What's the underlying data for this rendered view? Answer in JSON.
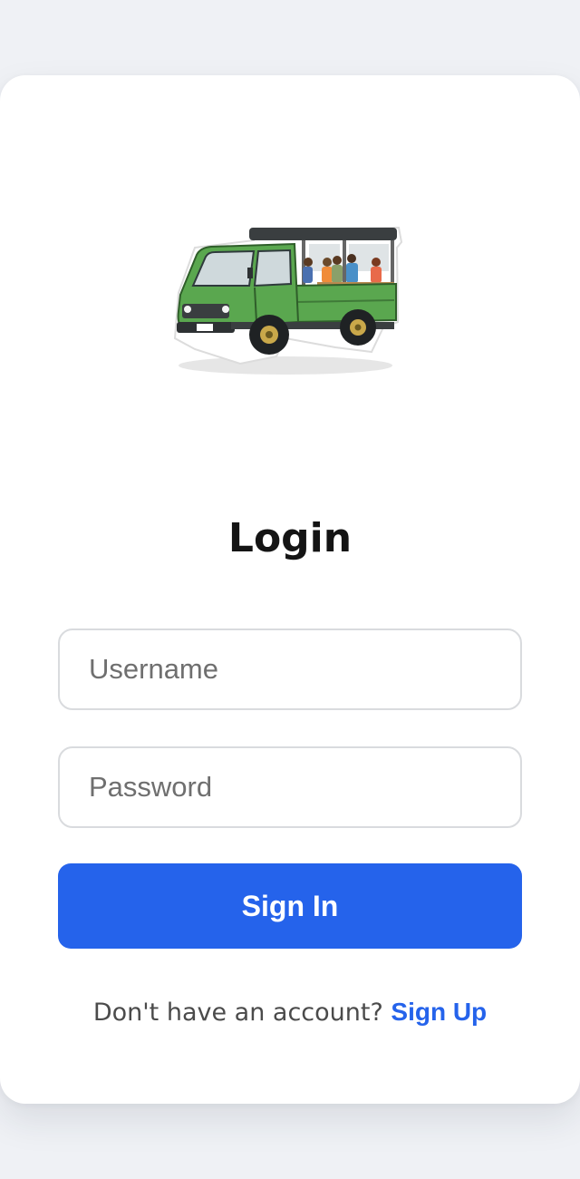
{
  "login": {
    "logo_icon": "songthaew-truck-icon",
    "title": "Login",
    "username_placeholder": "Username",
    "password_placeholder": "Password",
    "signin_label": "Sign In",
    "footer_prompt": "Don't have an account? ",
    "signup_label": "Sign Up"
  },
  "colors": {
    "primary": "#2563eb",
    "background": "#eff1f5",
    "card": "#ffffff",
    "truck_green": "#5aa74f"
  }
}
